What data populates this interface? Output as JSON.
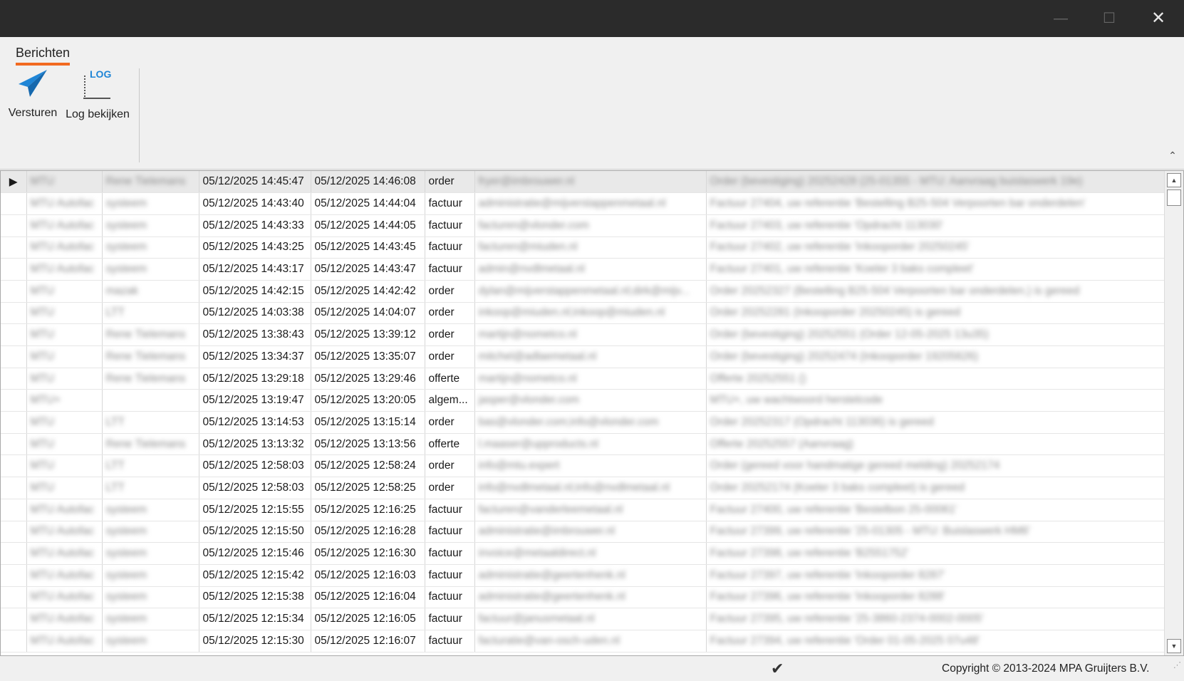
{
  "window": {
    "minimize_glyph": "—",
    "maximize_glyph": "☐",
    "close_glyph": "✕"
  },
  "ribbon": {
    "tab_label": "Berichten",
    "send_label": "Versturen",
    "send_icon": "paper-plane-icon",
    "log_label": "Log bekijken",
    "log_icon_text": "LOG",
    "accent_color": "#f26a21",
    "icon_color": "#1f85d6",
    "collapse_glyph": "⌃"
  },
  "grid": {
    "rows": [
      {
        "a": "MTU",
        "b": "Rene Tielemans",
        "sent": "05/12/2025 14:45:47",
        "done": "05/12/2025 14:46:08",
        "type": "order",
        "email": "fryer@imbrouwer.nl",
        "subject": "Order (bevestiging) 20252428 (25-01355 - MTU: Aanvraag buislaswerk 19e)",
        "selected": true
      },
      {
        "a": "MTU Autofac",
        "b": "systeem",
        "sent": "05/12/2025 14:43:40",
        "done": "05/12/2025 14:44:04",
        "type": "factuur",
        "email": "administratie@mijverstappenmetaal.nl",
        "subject": "Factuur 27404, uw referentie 'Bestelling B25-504 Verpoorten bar onderdelen'"
      },
      {
        "a": "MTU Autofac",
        "b": "systeem",
        "sent": "05/12/2025 14:43:33",
        "done": "05/12/2025 14:44:05",
        "type": "factuur",
        "email": "facturen@vlonder.com",
        "subject": "Factuur 27403, uw referentie 'Opdracht 113030'"
      },
      {
        "a": "MTU Autofac",
        "b": "systeem",
        "sent": "05/12/2025 14:43:25",
        "done": "05/12/2025 14:43:45",
        "type": "factuur",
        "email": "facturen@miuden.nl",
        "subject": "Factuur 27402, uw referentie 'Inkooporder 20250245'"
      },
      {
        "a": "MTU Autofac",
        "b": "systeem",
        "sent": "05/12/2025 14:43:17",
        "done": "05/12/2025 14:43:47",
        "type": "factuur",
        "email": "admin@nvdlmetaal.nl",
        "subject": "Factuur 27401, uw referentie 'Koeler 3 baks compleet'"
      },
      {
        "a": "MTU",
        "b": "mazak",
        "sent": "05/12/2025 14:42:15",
        "done": "05/12/2025 14:42:42",
        "type": "order",
        "email": "dylan@mijverstappenmetaal.nl;dirk@mijv...",
        "subject": "Order 20252327 (Bestelling B25-504 Verpoorten bar onderdelen.) is gereed"
      },
      {
        "a": "MTU",
        "b": "LTT",
        "sent": "05/12/2025 14:03:38",
        "done": "05/12/2025 14:04:07",
        "type": "order",
        "email": "inkoop@miuden.nl;inkoop@miuden.nl",
        "subject": "Order 20252281 (Inkooporder 20250245) is gereed"
      },
      {
        "a": "MTU",
        "b": "Rene Tielemans",
        "sent": "05/12/2025 13:38:43",
        "done": "05/12/2025 13:39:12",
        "type": "order",
        "email": "martijn@nometco.nl",
        "subject": "Order (bevestiging) 20252551 (Order 12-05-2025 13u35)"
      },
      {
        "a": "MTU",
        "b": "Rene Tielemans",
        "sent": "05/12/2025 13:34:37",
        "done": "05/12/2025 13:35:07",
        "type": "order",
        "email": "mitchel@adlaemetaal.nl",
        "subject": "Order (bevestiging) 20252474 (Inkooporder 19205626)"
      },
      {
        "a": "MTU",
        "b": "Rene Tielemans",
        "sent": "05/12/2025 13:29:18",
        "done": "05/12/2025 13:29:46",
        "type": "offerte",
        "email": "martijn@nometco.nl",
        "subject": "Offerte 20252551 ()"
      },
      {
        "a": "MTU+",
        "b": "",
        "sent": "05/12/2025 13:19:47",
        "done": "05/12/2025 13:20:05",
        "type": "algem...",
        "email": "jasper@vlonder.com",
        "subject": "MTU+, uw wachtwoord herstelcode"
      },
      {
        "a": "MTU",
        "b": "LTT",
        "sent": "05/12/2025 13:14:53",
        "done": "05/12/2025 13:15:14",
        "type": "order",
        "email": "bas@vlonder.com;info@vlonder.com",
        "subject": "Order 20252317 (Opdracht 113036) is gereed"
      },
      {
        "a": "MTU",
        "b": "Rene Tielemans",
        "sent": "05/12/2025 13:13:32",
        "done": "05/12/2025 13:13:56",
        "type": "offerte",
        "email": "l.maaser@upproducts.nl",
        "subject": "Offerte 20252557 (Aanvraag)"
      },
      {
        "a": "MTU",
        "b": "LTT",
        "sent": "05/12/2025 12:58:03",
        "done": "05/12/2025 12:58:24",
        "type": "order",
        "email": "info@mtu.expert",
        "subject": "Order (gereed voor handmatige gereed melding) 20252174"
      },
      {
        "a": "MTU",
        "b": "LTT",
        "sent": "05/12/2025 12:58:03",
        "done": "05/12/2025 12:58:25",
        "type": "order",
        "email": "info@nvdlmetaal.nl;info@nvdlmetaal.nl",
        "subject": "Order 20252174 (Koeler 3 baks compleet) is gereed"
      },
      {
        "a": "MTU Autofac",
        "b": "systeem",
        "sent": "05/12/2025 12:15:55",
        "done": "05/12/2025 12:16:25",
        "type": "factuur",
        "email": "facturen@vanderleemetaal.nl",
        "subject": "Factuur 27400, uw referentie 'Bestelbon 25-00061'"
      },
      {
        "a": "MTU Autofac",
        "b": "systeem",
        "sent": "05/12/2025 12:15:50",
        "done": "05/12/2025 12:16:28",
        "type": "factuur",
        "email": "administratie@imbrouwer.nl",
        "subject": "Factuur 27399, uw referentie '25-01305 - MTU: Buislaswerk HM6'"
      },
      {
        "a": "MTU Autofac",
        "b": "systeem",
        "sent": "05/12/2025 12:15:46",
        "done": "05/12/2025 12:16:30",
        "type": "factuur",
        "email": "invoice@metaaldirect.nl",
        "subject": "Factuur 27398, uw referentie 'B2551752'"
      },
      {
        "a": "MTU Autofac",
        "b": "systeem",
        "sent": "05/12/2025 12:15:42",
        "done": "05/12/2025 12:16:03",
        "type": "factuur",
        "email": "administratie@geertenhenk.nl",
        "subject": "Factuur 27397, uw referentie 'Inkooporder 8287'"
      },
      {
        "a": "MTU Autofac",
        "b": "systeem",
        "sent": "05/12/2025 12:15:38",
        "done": "05/12/2025 12:16:04",
        "type": "factuur",
        "email": "administratie@geertenhenk.nl",
        "subject": "Factuur 27396, uw referentie 'Inkooporder 8288'"
      },
      {
        "a": "MTU Autofac",
        "b": "systeem",
        "sent": "05/12/2025 12:15:34",
        "done": "05/12/2025 12:16:05",
        "type": "factuur",
        "email": "factuur@janusmetaal.nl",
        "subject": "Factuur 27395, uw referentie '25-3860-2374-0002-0005'"
      },
      {
        "a": "MTU Autofac",
        "b": "systeem",
        "sent": "05/12/2025 12:15:30",
        "done": "05/12/2025 12:16:07",
        "type": "factuur",
        "email": "facturatie@van-osch-uden.nl",
        "subject": "Factuur 27394, uw referentie 'Order 01-05-2025 07u48'"
      }
    ]
  },
  "status": {
    "check_glyph": "✔",
    "copyright": "Copyright © 2013-2024 MPA Gruijters B.V."
  }
}
